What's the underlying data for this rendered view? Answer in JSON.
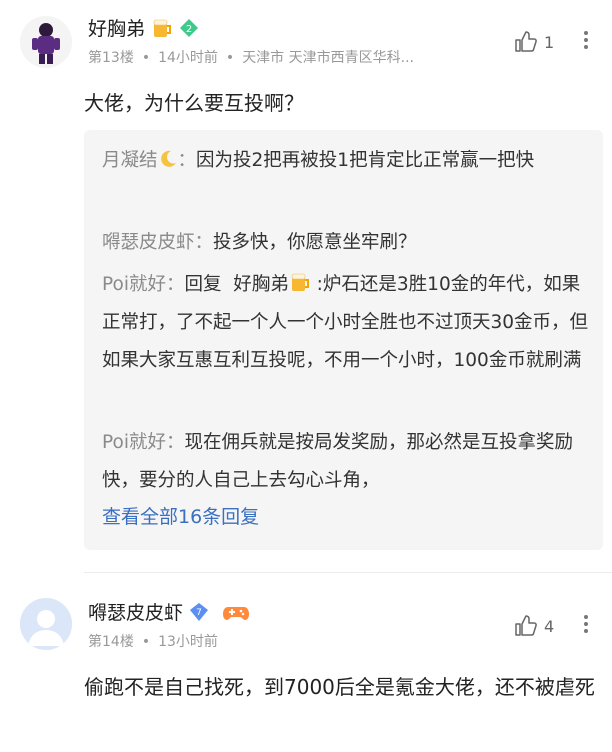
{
  "comments": [
    {
      "username": "好胸弟",
      "floor": "第13楼",
      "time": "14小时前",
      "location": "天津市 天津市西青区华科...",
      "likes": "1",
      "text": "大佬，为什么要互投啊？",
      "badge_level": "2",
      "replies": [
        {
          "name": "月凝结",
          "text": "因为投2把再被投1把肯定比正常赢一把快"
        },
        {
          "name": "嘚瑟皮皮虾",
          "text": "投多快，你愿意坐牢刷？"
        },
        {
          "name": "Poi就好",
          "reply_prefix": "回复",
          "reply_to": "好胸弟",
          "text": ":炉石还是3胜10金的年代，如果正常打，了不起一个人一个小时全胜也不过顶天30金币，但如果大家互惠互利互投呢，不用一个小时，100金币就刷满"
        },
        {
          "name": "Poi就好",
          "text": "现在佣兵就是按局发奖励，那必然是互投拿奖励快，要分的人自己上去勾心斗角，"
        }
      ],
      "view_all": "查看全部16条回复"
    },
    {
      "username": "嘚瑟皮皮虾",
      "floor": "第14楼",
      "time": "13小时前",
      "likes": "4",
      "text": "偷跑不是自己找死，到7000后全是氪金大佬，还不被虐死",
      "badge_level": "7"
    }
  ],
  "colors": {
    "link": "#3b6fc1",
    "meta": "#999999",
    "reply_bg": "#f5f5f5",
    "badge_green": "#3fc98a",
    "badge_blue": "#5b8ff0"
  }
}
